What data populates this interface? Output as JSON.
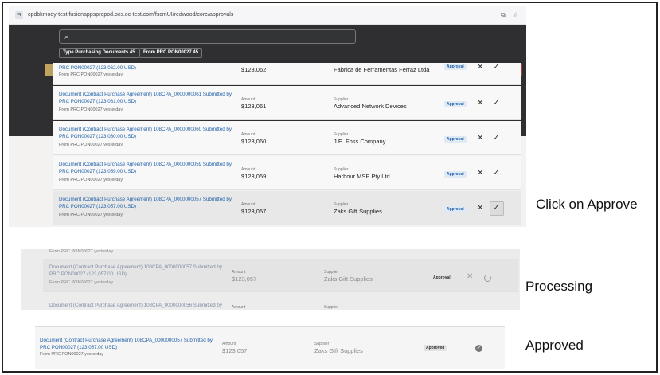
{
  "browser": {
    "url": "cpdbkmoqy-test.fusionappsprepod.ocs.oc-test.com/fscmUI/redwood/core/approvals"
  },
  "filters": {
    "search_placeholder": "",
    "chip_type": "Type Purchasing Documents  45",
    "chip_from": "From PRC PON00027  45"
  },
  "top_rows": [
    {
      "doc": "PRC PON00027 (123,062.00 USD)",
      "from": "From PRC PON00027 yesterday",
      "amount_label": "",
      "amount": "$123,062",
      "supplier_label": "",
      "supplier": "Fabrica de Ferramentas Ferraz Ltda",
      "status": "Approval"
    },
    {
      "doc": "Document (Contract Purchase Agreement) 108CPA_0000000061 Submitted by PRC PON00027 (123,061.00 USD)",
      "from": "From PRC PON00027 yesterday",
      "amount_label": "Amount",
      "amount": "$123,061",
      "supplier_label": "Supplier",
      "supplier": "Advanced Network Devices",
      "status": "Approval"
    },
    {
      "doc": "Document (Contract Purchase Agreement) 108CPA_0000000060 Submitted by PRC PON00027 (123,060.00 USD)",
      "from": "From PRC PON00027 yesterday",
      "amount_label": "Amount",
      "amount": "$123,060",
      "supplier_label": "Supplier",
      "supplier": "J.E. Foss Company",
      "status": "Approval"
    },
    {
      "doc": "Document (Contract Purchase Agreement) 108CPA_0000000059 Submitted by PRC PON00027 (123,059.00 USD)",
      "from": "From PRC PON00027 yesterday",
      "amount_label": "Amount",
      "amount": "$123,059",
      "supplier_label": "Supplier",
      "supplier": "Harbour MSP Pty Ltd",
      "status": "Approval"
    },
    {
      "doc": "Document (Contract Purchase Agreement) 108CPA_0000000057 Submitted by PRC PON00027 (123,057.00 USD)",
      "from": "From PRC PON00027 yesterday",
      "amount_label": "Amount",
      "amount": "$123,057",
      "supplier_label": "Supplier",
      "supplier": "Zaks Gift Supplies",
      "status": "Approval"
    }
  ],
  "captions": {
    "click": "Click on Approve",
    "processing": "Processing",
    "approved": "Approved"
  },
  "processing": {
    "prev_from": "From PRC PON00027 yesterday",
    "doc": "Document (Contract Purchase Agreement) 108CPA_0000000057 Submitted by PRC PON00027 (123,057.00 USD)",
    "from": "From PRC PON00027 yesterday",
    "amount_label": "Amount",
    "amount": "$123,057",
    "supplier_label": "Supplier",
    "supplier": "Zaks Gift Supplies",
    "status": "Approval",
    "next_doc": "Document (Contract Purchase Agreement) 108CPA_0000000056 Submitted by",
    "next_amount_label": "Amount",
    "next_supplier_label": "Supplier"
  },
  "approved": {
    "doc": "Document (Contract Purchase Agreement) 108CPA_0000000057 Submitted by PRC PON00027 (123,057.00 USD)",
    "from": "From PRC PON00027 yesterday",
    "amount_label": "Amount",
    "amount": "$123,057",
    "supplier_label": "Supplier",
    "supplier": "Zaks Gift Supplies",
    "status": "Approved"
  },
  "icons": {
    "reject": "✕",
    "approve": "✓",
    "done": "✓"
  }
}
